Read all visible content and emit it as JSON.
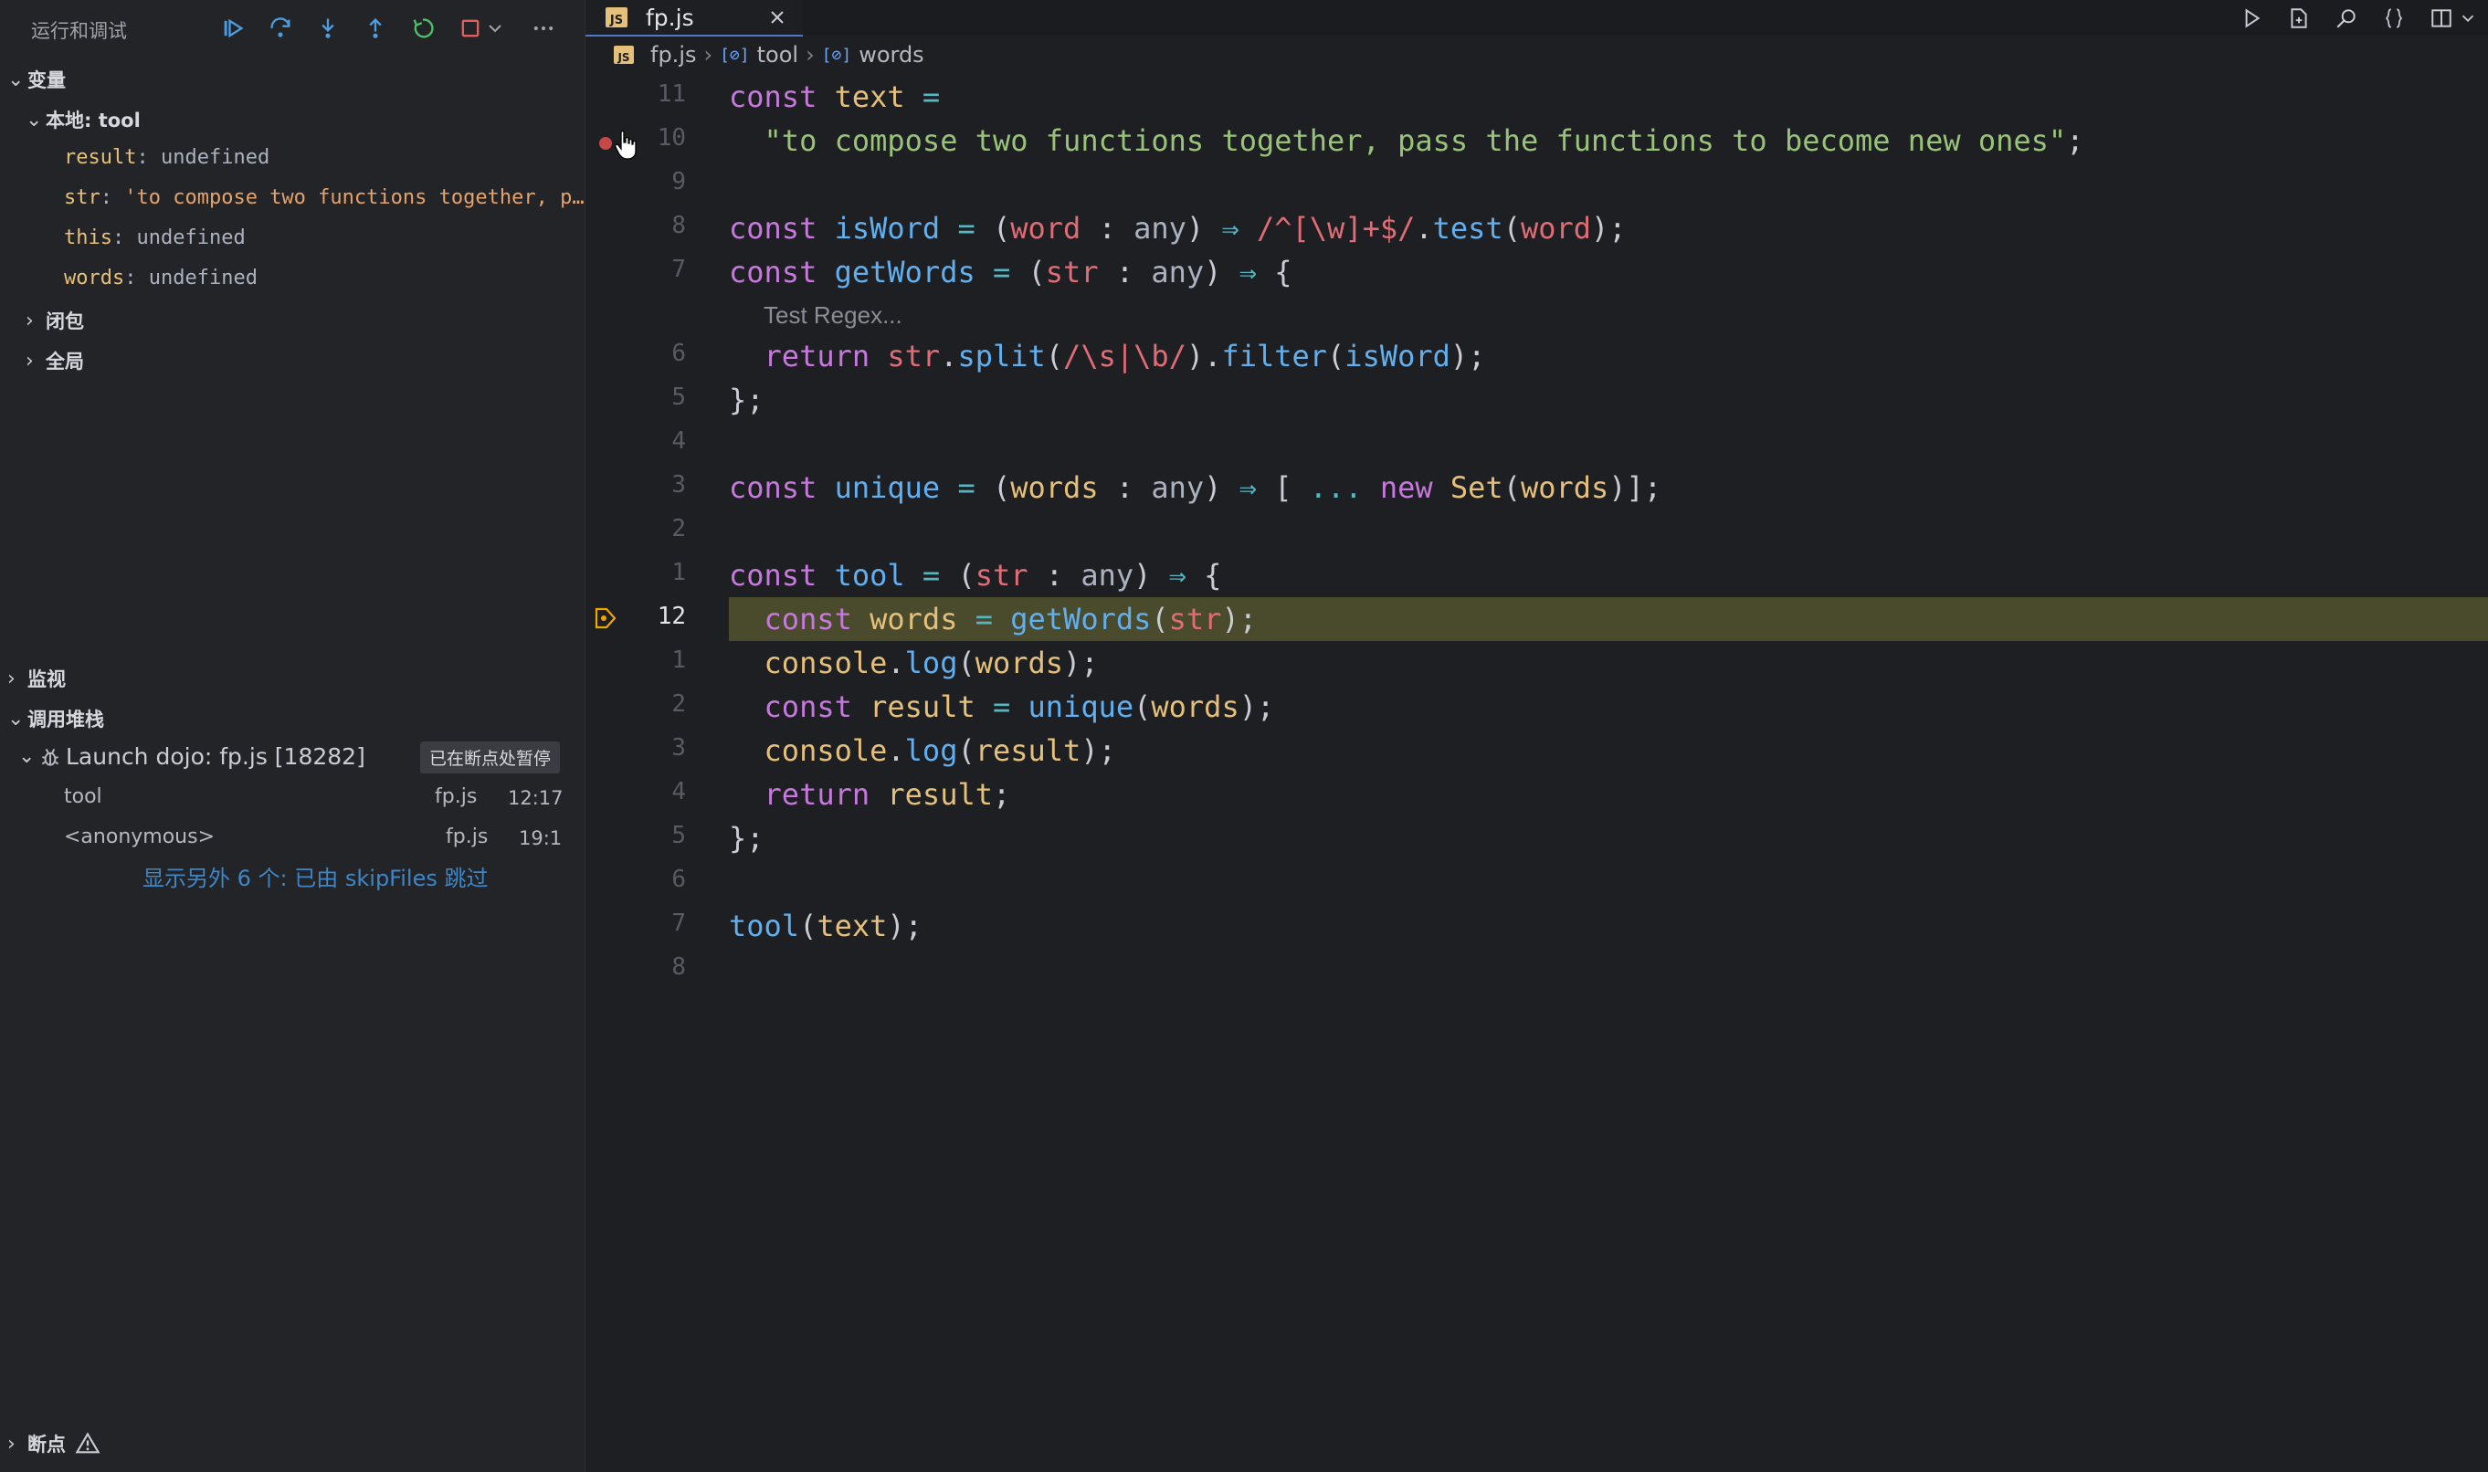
{
  "sidebar": {
    "title": "运行和调试",
    "variables_header": "变量",
    "local_scope": "本地: tool",
    "variables": [
      {
        "name": "result",
        "value": "undefined",
        "kind": "undef"
      },
      {
        "name": "str",
        "value": "'to compose two functions together, p…",
        "kind": "string"
      },
      {
        "name": "this",
        "value": "undefined",
        "kind": "undef"
      },
      {
        "name": "words",
        "value": "undefined",
        "kind": "undef"
      }
    ],
    "closure_scope": "闭包",
    "global_scope": "全局",
    "watch_header": "监视",
    "callstack_header": "调用堆栈",
    "session_name": "Launch dojo: fp.js [18282]",
    "session_status": "已在断点处暂停",
    "frames": [
      {
        "name": "tool",
        "file": "fp.js",
        "pos": "12:17"
      },
      {
        "name": "<anonymous>",
        "file": "fp.js",
        "pos": "19:1"
      }
    ],
    "skip_link": "显示另外 6 个: 已由 skipFiles 跳过",
    "breakpoints_header": "断点"
  },
  "editor": {
    "tab_label": "fp.js",
    "js_badge": "JS",
    "breadcrumb": {
      "file": "fp.js",
      "sym1": "tool",
      "sym2": "words",
      "sym_glyph": "[⊘]"
    },
    "codelens": "Test Regex...",
    "line_numbers": [
      "11",
      "10",
      "9",
      "8",
      "7",
      "6",
      "5",
      "4",
      "3",
      "2",
      "1",
      "12",
      "1",
      "2",
      "3",
      "4",
      "5",
      "6",
      "7",
      "8"
    ],
    "code_lines": [
      "const text =",
      "  \"to compose two functions together, pass the functions to become new ones\";",
      "",
      "const isWord = (word : any) ⇒ /^[\\w]+$/.test(word);",
      "const getWords = (str : any) ⇒ {",
      "  return str.split(/\\s|\\b/).filter(isWord);",
      "};",
      "",
      "const unique = (words : any) ⇒ [ ... new Set(words)];",
      "",
      "const tool = (str : any) ⇒ {",
      "  const words = getWords(str);",
      "  console.log(words);",
      "  const result = unique(words);",
      "  console.log(result);",
      "  return result;",
      "};",
      "",
      "tool(text);",
      ""
    ]
  },
  "colors": {
    "accent": "#4d78cc",
    "debug_line": "#4a4b2c",
    "breakpoint": "#c64848",
    "link": "#3f86c7"
  }
}
